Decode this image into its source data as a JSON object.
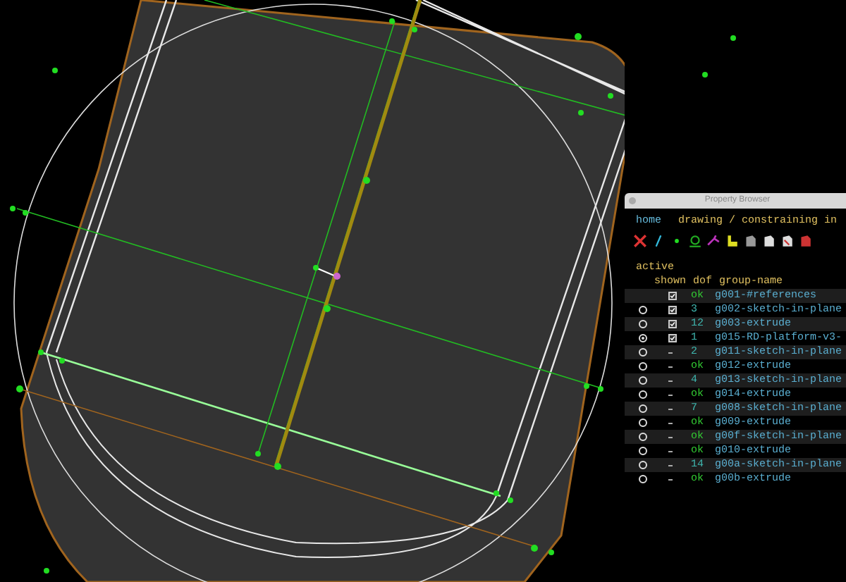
{
  "panel": {
    "title": "Property Browser",
    "nav": [
      {
        "label": "home"
      },
      {
        "label": "drawing / constraining in"
      }
    ],
    "section": "active",
    "columns": [
      "shown",
      "dof",
      "group-name"
    ],
    "rows": [
      {
        "active": null,
        "shown": true,
        "dof": "ok",
        "name": "g001-#references"
      },
      {
        "active": false,
        "shown": true,
        "dof": "3",
        "name": "g002-sketch-in-plane"
      },
      {
        "active": false,
        "shown": true,
        "dof": "12",
        "name": "g003-extrude"
      },
      {
        "active": true,
        "shown": true,
        "dof": "1",
        "name": "g015-RD-platform-v3-"
      },
      {
        "active": false,
        "shown": false,
        "dof": "2",
        "name": "g011-sketch-in-plane"
      },
      {
        "active": false,
        "shown": false,
        "dof": "ok",
        "name": "g012-extrude"
      },
      {
        "active": false,
        "shown": false,
        "dof": "4",
        "name": "g013-sketch-in-plane"
      },
      {
        "active": false,
        "shown": false,
        "dof": "ok",
        "name": "g014-extrude"
      },
      {
        "active": false,
        "shown": false,
        "dof": "7",
        "name": "g008-sketch-in-plane"
      },
      {
        "active": false,
        "shown": false,
        "dof": "ok",
        "name": "g009-extrude"
      },
      {
        "active": false,
        "shown": false,
        "dof": "ok",
        "name": "g00f-sketch-in-plane"
      },
      {
        "active": false,
        "shown": false,
        "dof": "ok",
        "name": "g010-extrude"
      },
      {
        "active": false,
        "shown": false,
        "dof": "14",
        "name": "g00a-sketch-in-plane"
      },
      {
        "active": false,
        "shown": false,
        "dof": "ok",
        "name": "g00b-extrude"
      }
    ]
  }
}
